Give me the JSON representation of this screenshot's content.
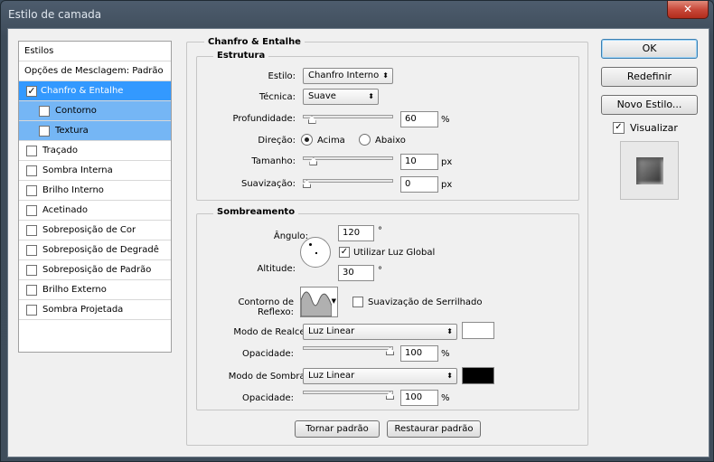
{
  "window": {
    "title": "Estilo de camada",
    "close_glyph": "✕"
  },
  "styles_panel": {
    "header": "Estilos",
    "blend_options": "Opções de Mesclagem: Padrão",
    "items": [
      {
        "label": "Chanfro & Entalhe",
        "checked": true
      },
      {
        "label": "Contorno",
        "checked": false
      },
      {
        "label": "Textura",
        "checked": false
      },
      {
        "label": "Traçado",
        "checked": false
      },
      {
        "label": "Sombra Interna",
        "checked": false
      },
      {
        "label": "Brilho Interno",
        "checked": false
      },
      {
        "label": "Acetinado",
        "checked": false
      },
      {
        "label": "Sobreposição de Cor",
        "checked": false
      },
      {
        "label": "Sobreposição de Degradê",
        "checked": false
      },
      {
        "label": "Sobreposição de Padrão",
        "checked": false
      },
      {
        "label": "Brilho Externo",
        "checked": false
      },
      {
        "label": "Sombra Projetada",
        "checked": false
      }
    ]
  },
  "bevel": {
    "section_title": "Chanfro & Entalhe",
    "structure": {
      "title": "Estrutura",
      "style_label": "Estilo:",
      "style_value": "Chanfro Interno",
      "technique_label": "Técnica:",
      "technique_value": "Suave",
      "depth_label": "Profundidade:",
      "depth_value": "60",
      "depth_unit": "%",
      "depth_level": 0.06,
      "direction_label": "Direção:",
      "dir_up": "Acima",
      "dir_down": "Abaixo",
      "direction_selected": "Acima",
      "size_label": "Tamanho:",
      "size_value": "10",
      "size_unit": "px",
      "size_level": 0.08,
      "soften_label": "Suavização:",
      "soften_value": "0",
      "soften_unit": "px",
      "soften_level": 0.0
    },
    "shading": {
      "title": "Sombreamento",
      "angle_label": "Ângulo:",
      "angle_value": "120",
      "angle_unit": "°",
      "global_light_label": "Utilizar Luz Global",
      "global_light_checked": true,
      "altitude_label": "Altitude:",
      "altitude_value": "30",
      "altitude_unit": "°",
      "gloss_label": "Contorno de Reflexo:",
      "antialias_label": "Suavização de Serrilhado",
      "antialias_checked": false,
      "highlight_mode_label": "Modo de Realce:",
      "highlight_mode_value": "Luz Linear",
      "highlight_color": "#ffffff",
      "highlight_opacity_label": "Opacidade:",
      "highlight_opacity_value": "100",
      "highlight_opacity_unit": "%",
      "highlight_opacity_level": 1.0,
      "shadow_mode_label": "Modo de Sombra:",
      "shadow_mode_value": "Luz Linear",
      "shadow_color": "#000000",
      "shadow_opacity_label": "Opacidade:",
      "shadow_opacity_value": "100",
      "shadow_opacity_unit": "%",
      "shadow_opacity_level": 1.0
    },
    "make_default": "Tornar padrão",
    "reset_default": "Restaurar padrão"
  },
  "actions": {
    "ok": "OK",
    "cancel": "Redefinir",
    "new_style": "Novo Estilo...",
    "preview_label": "Visualizar",
    "preview_checked": true
  },
  "colors": {
    "selection": "#3399ff",
    "sub_selection": "#75b6f5",
    "accent_border": "#3c7fb1"
  }
}
